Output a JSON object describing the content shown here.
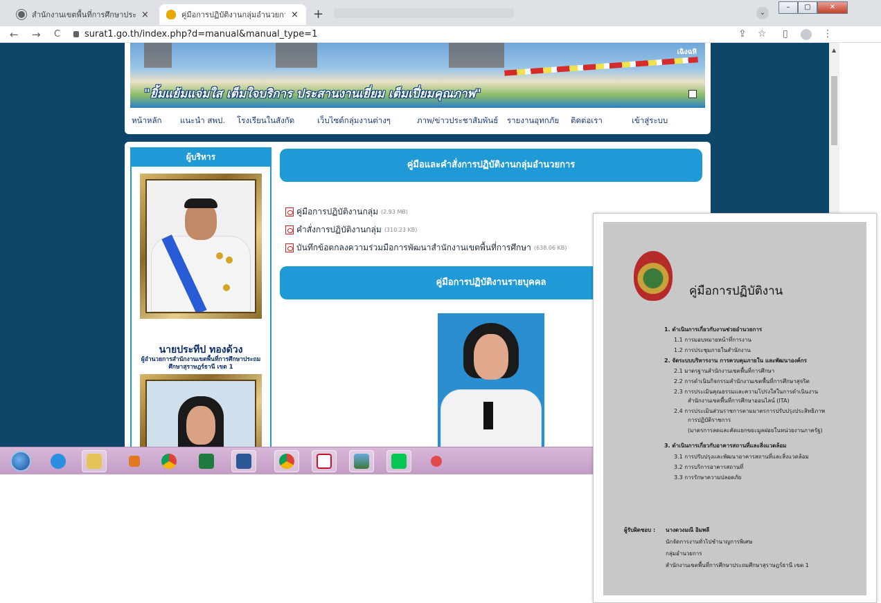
{
  "browser": {
    "tabs": [
      {
        "title": "สำนักงานเขตพื้นที่การศึกษาประถมศึกษ",
        "close": "×"
      },
      {
        "title": "คู่มือการปฏิบัติงานกลุ่มอำนวยการ :: ส่",
        "close": "×"
      }
    ],
    "new_tab": "+",
    "url": "surat1.go.th/index.php?d=manual&manual_type=1",
    "nav": {
      "back": "←",
      "forward": "→",
      "reload": "C"
    },
    "tools": {
      "share": "⇪",
      "star": "☆",
      "sidebar": "▯",
      "menu": "⋮"
    },
    "chevron": "⌄",
    "window": {
      "minimize": "–",
      "maximize": "▢",
      "close": "✕"
    }
  },
  "banner": {
    "slogan": "\"ยิ้มแย้มแจ่มใส เต็มใจบริการ ประสานงานเยี่ยม เต็มเปี่ยมคุณภาพ\"",
    "watermark": "เฉิงฉหิ"
  },
  "menu": [
    "หน้าหลัก",
    "แนะนำ สพป.",
    "โรงเรียนในสังกัด",
    "เว็บไซต์กลุ่มงานต่างๆ",
    "ภาพ/ข่าวประชาสัมพันธ์",
    "รายงานอุทกภัย",
    "ติดต่อเรา",
    "เข้าสู่ระบบ"
  ],
  "sidebar": {
    "heading": "ผู้บริหาร",
    "executive_name": "นายประทีป ทองด้วง",
    "executive_title": "ผู้อำนวยการสำนักงานเขตพื้นที่การศึกษาประถมศึกษาสุราษฎร์ธานี เขต 1"
  },
  "content": {
    "section1_title": "คู่มือและคำสั่งการปฏิบัติงานกลุ่มอำนวยการ",
    "documents": [
      {
        "label": "คู่มือการปฏิบัติงานกลุ่ม",
        "size": "(2.93 MB)"
      },
      {
        "label": "คำสั่งการปฏิบัติงานกลุ่ม",
        "size": "(310.23 KB)"
      },
      {
        "label": "บันทึกข้อตกลงความร่วมมือการพัฒนาสำนักงานเขตพื้นที่การศึกษา",
        "size": "(638.06 KB)"
      }
    ],
    "section2_title": "คู่มือการปฏิบัติงานรายบุคคล"
  },
  "taskbar": {
    "items": [
      "windows-start",
      "internet-explorer",
      "file-explorer",
      "media-player",
      "chrome",
      "excel",
      "word",
      "chrome-2",
      "acrobat",
      "photo-viewer",
      "line",
      "snipping-tool"
    ]
  },
  "doc_preview": {
    "title": "คู่มือการปฏิบัติงาน",
    "lines": [
      {
        "text": "1.  ดำเนินการเกี่ยวกับงานช่วยอำนวยการ",
        "h": true
      },
      {
        "text": "1.1  การมอบหมายหน้าที่การงาน",
        "h": false
      },
      {
        "text": "1.2  การประชุมภายในสำนักงาน",
        "h": false
      },
      {
        "text": "2.  จัดระบบบริหารงาน การควบคุมภายใน  และพัฒนาองค์กร",
        "h": true
      },
      {
        "text": "2.1  มาตรฐานสำนักงานเขตพื้นที่การศึกษา",
        "h": false
      },
      {
        "text": "2.2  การดำเนินกิจกรรมสำนักงานเขตพื้นที่การศึกษาสุจริต",
        "h": false
      },
      {
        "text": "2.3  การประเมินคุณธรรมและความโปร่งใสในการดำเนินงาน",
        "h": false
      },
      {
        "text": "สำนักงานเขตพื้นที่การศึกษาออนไลน์ (ITA)",
        "h": false
      },
      {
        "text": "2.4  การประเมินส่วนราชการตามมาตรการปรับปรุงประสิทธิภาพ",
        "h": false
      },
      {
        "text": "การปฏิบัติราชการ",
        "h": false
      },
      {
        "text": "(มาตรการลดและคัดแยกขยะมูลฝอยในหน่วยงานภาครัฐ)",
        "h": false
      },
      {
        "text": "3.  ดำเนินการเกี่ยวกับอาคารสถานที่และสิ่งแวดล้อม",
        "h": true
      },
      {
        "text": "3.1  การปรับปรุงและพัฒนาอาคารสถานที่และสิ่งแวดล้อม",
        "h": false
      },
      {
        "text": "3.2  การบริการอาคารสถานที่",
        "h": false
      },
      {
        "text": "3.3  การรักษาความปลอดภัย",
        "h": false
      }
    ],
    "responsible_label": "ผู้รับผิดชอบ :",
    "responsible_name": "นางดวงมณี  อิมพลี",
    "responsible_lines": [
      "นักจัดการงานทั่วไปชำนาญการพิเศษ",
      "กลุ่มอำนวยการ",
      "สำนักงานเขตพื้นที่การศึกษาประถมศึกษาสุราษฎร์ธานี เขต 1"
    ]
  }
}
